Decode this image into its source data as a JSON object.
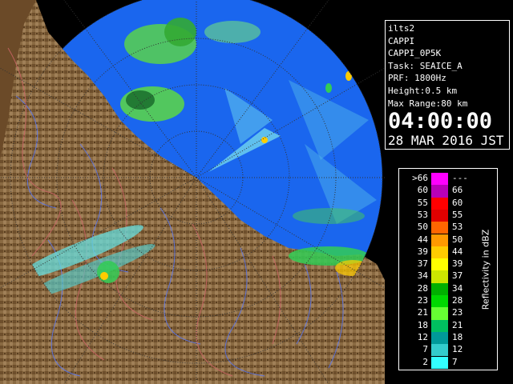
{
  "info": {
    "site": "ilts2",
    "product": "CAPPI",
    "product_name": "CAPPI_0P5K",
    "task": "Task: SEAICE_A",
    "prf": "PRF: 1800Hz",
    "height": "Height:0.5 km",
    "max_range": "Max Range:80 km",
    "time": "04:00:00",
    "date": "28 MAR 2016 JST"
  },
  "legend": {
    "title": "Reflectivity in dBZ",
    "bins": [
      {
        "low": ">66",
        "high": "---",
        "color": "#ff00ff"
      },
      {
        "low": "60",
        "high": "66",
        "color": "#b800b8"
      },
      {
        "low": "55",
        "high": "60",
        "color": "#ff0000"
      },
      {
        "low": "53",
        "high": "55",
        "color": "#e00000"
      },
      {
        "low": "50",
        "high": "53",
        "color": "#ff6600"
      },
      {
        "low": "44",
        "high": "50",
        "color": "#ff9900"
      },
      {
        "low": "39",
        "high": "44",
        "color": "#ffcc00"
      },
      {
        "low": "37",
        "high": "39",
        "color": "#ffff00"
      },
      {
        "low": "34",
        "high": "37",
        "color": "#cce600"
      },
      {
        "low": "28",
        "high": "34",
        "color": "#00b000"
      },
      {
        "low": "23",
        "high": "28",
        "color": "#00d800"
      },
      {
        "low": "21",
        "high": "23",
        "color": "#66ff33"
      },
      {
        "low": "18",
        "high": "21",
        "color": "#00c060"
      },
      {
        "low": "12",
        "high": "18",
        "color": "#009999"
      },
      {
        "low": "7",
        "high": "12",
        "color": "#33cccc"
      },
      {
        "low": "2",
        "high": "7",
        "color": "#33ffff"
      }
    ]
  },
  "map": {
    "sea_color": "#1a66ee",
    "land_color": "#7a5a35",
    "range_rings": "dotted"
  }
}
